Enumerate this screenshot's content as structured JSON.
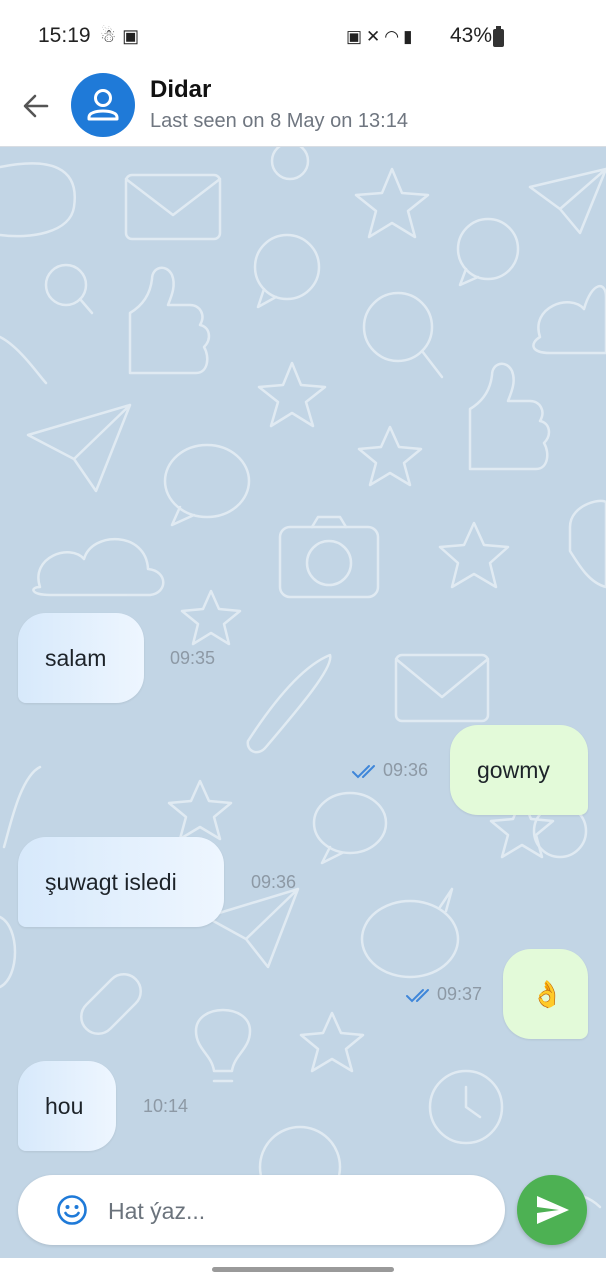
{
  "status_bar": {
    "time": "15:19",
    "left_icons": [
      "notification-icon",
      "gallery-icon"
    ],
    "left_glyphs": "☃▣",
    "right_icons": [
      "battery-saver-icon",
      "mute-icon",
      "wifi-icon",
      "signal-icon"
    ],
    "right_glyphs": "▣✕◠▮",
    "battery_percent": "43%"
  },
  "header": {
    "contact_name": "Didar",
    "last_seen": "Last seen on 8 May on 13:14"
  },
  "messages": [
    {
      "direction": "incoming",
      "text": "salam",
      "time": "09:35"
    },
    {
      "direction": "outgoing",
      "text": "gowmy",
      "time": "09:36",
      "read": true
    },
    {
      "direction": "incoming",
      "text": "şuwagt isledi",
      "time": "09:36"
    },
    {
      "direction": "outgoing",
      "text": "👌",
      "time": "09:37",
      "read": true
    },
    {
      "direction": "incoming",
      "text": "hou",
      "time": "10:14"
    }
  ],
  "composer": {
    "placeholder": "Hat ýaz..."
  },
  "colors": {
    "accent": "#1f7ad8",
    "send": "#4db153",
    "chat_background": "#c2d5e5",
    "incoming_bubble": "#e2effc",
    "outgoing_bubble": "#e3fad9",
    "tick": "#3f86d9"
  }
}
